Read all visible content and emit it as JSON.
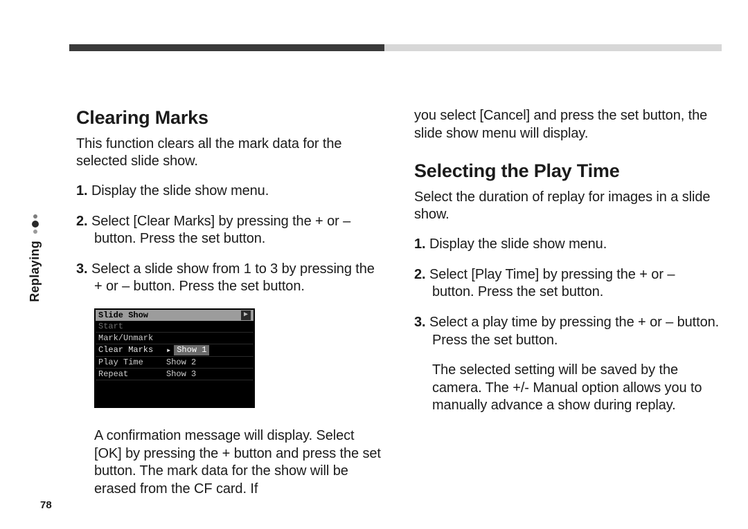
{
  "sideTab": {
    "label": "Replaying",
    "pageNumber": "78"
  },
  "left": {
    "heading": "Clearing Marks",
    "lead": "This function clears all the mark data for the selected slide show.",
    "steps": {
      "s1": {
        "n": "1.",
        "t": "Display the slide show menu."
      },
      "s2": {
        "n": "2.",
        "t": "Select [Clear Marks] by pressing the + or – button. Press the set button."
      },
      "s3": {
        "n": "3.",
        "t": "Select a slide show from 1 to 3 by pressing the + or – button. Press the set button."
      }
    },
    "shot": {
      "title": "Slide Show",
      "items": {
        "start": "Start",
        "mark": "Mark/Unmark",
        "clear": "Clear Marks",
        "play": "Play Time",
        "repeat": "Repeat",
        "show1": "Show 1",
        "show2": "Show 2",
        "show3": "Show 3"
      }
    },
    "after": "A confirmation message will display. Select [OK] by pressing the + button and press the set button. The mark data for the show will be erased from the CF card. If"
  },
  "right": {
    "cont": "you select [Cancel] and press the set button, the slide show menu will display.",
    "heading": "Selecting the Play Time",
    "lead": "Select the duration of replay for images in a slide show.",
    "steps": {
      "s1": {
        "n": "1.",
        "t": "Display the slide show menu."
      },
      "s2": {
        "n": "2.",
        "t": "Select [Play Time] by pressing the + or – button. Press the set button."
      },
      "s3": {
        "n": "3.",
        "t": "Select a play time by pressing the + or – button. Press the set button."
      }
    },
    "after": "The selected setting will be saved by the camera. The +/- Manual option allows you to manually advance a show during replay."
  }
}
